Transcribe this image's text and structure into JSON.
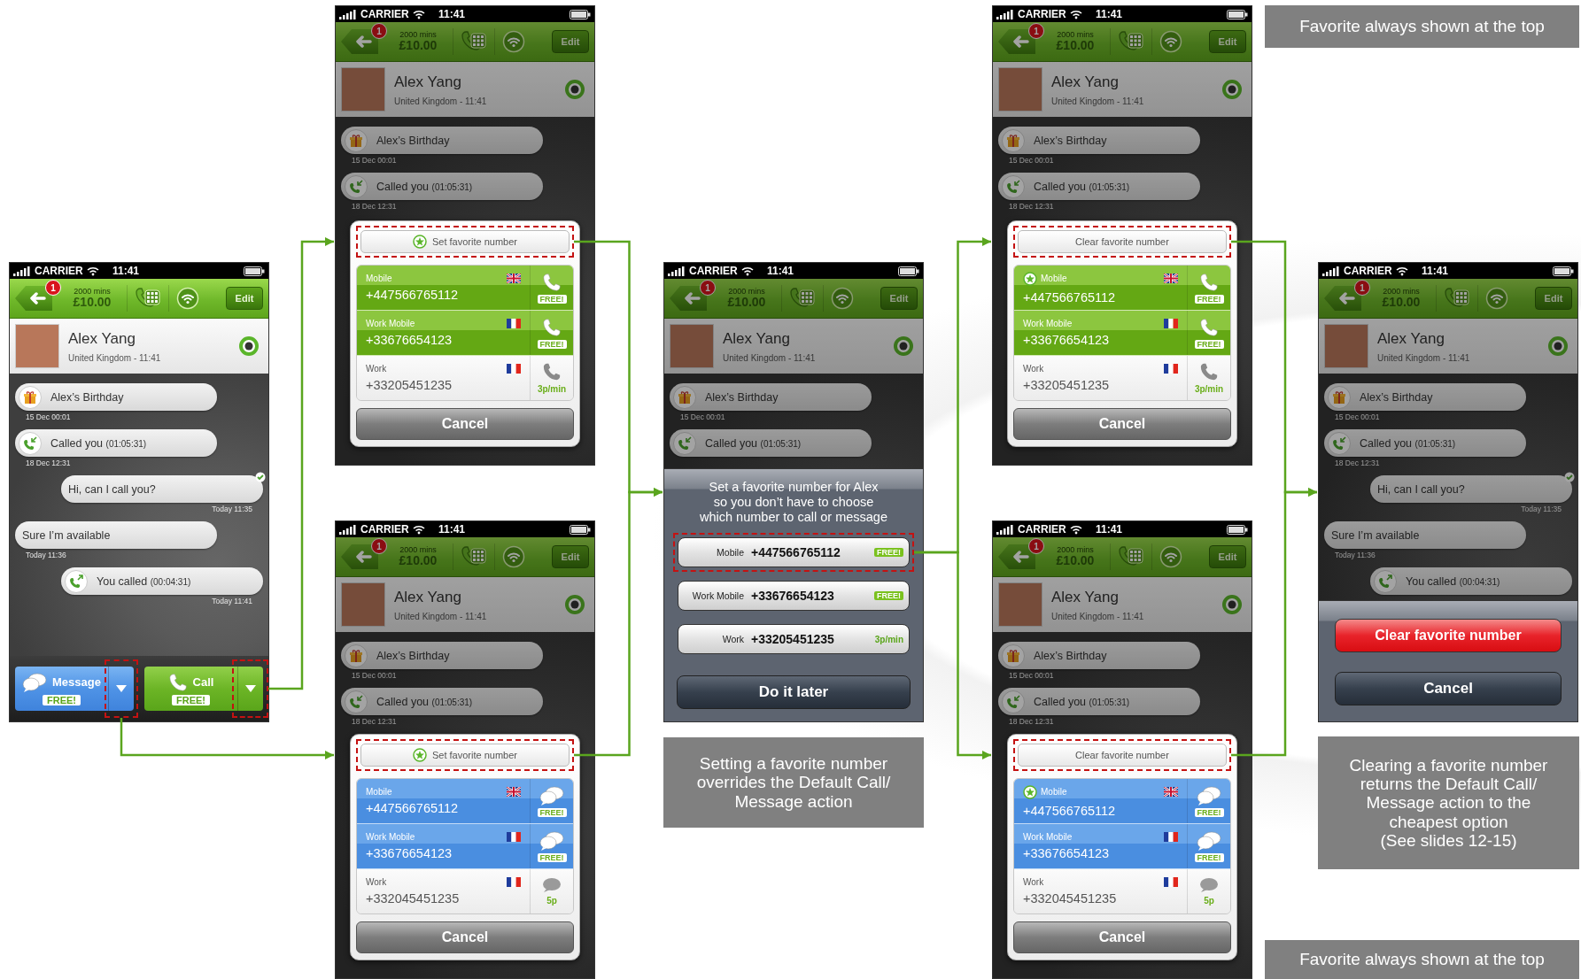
{
  "phones": [
    {
      "kind": "conversation",
      "dimmed": false,
      "status": {
        "carrier": "CARRIER",
        "time": "11:41"
      },
      "toolbar": {
        "badge": "1",
        "minutes": "2000 mins",
        "balance": "£10.00",
        "edit": "Edit"
      },
      "contact": {
        "name": "Alex Yang",
        "subtitle": "United Kingdom - 11:41"
      },
      "messages": [
        {
          "kind": "birthday",
          "outgoing": false,
          "delivered": false,
          "text": "Alex’s Birthday",
          "time": "15 Dec 00:01"
        },
        {
          "kind": "call_in",
          "outgoing": false,
          "delivered": false,
          "text": "Called you",
          "detail": "(01:05:31)",
          "time": "18 Dec 12:31"
        },
        {
          "kind": "text",
          "outgoing": true,
          "delivered": true,
          "text": "Hi, can I call you?",
          "time": "Today 11:35"
        },
        {
          "kind": "text",
          "outgoing": false,
          "delivered": false,
          "text": "Sure I’m available",
          "time": "Today 11:36"
        },
        {
          "kind": "call_out",
          "outgoing": true,
          "delivered": false,
          "text": "You called",
          "detail": "(00:04:31)",
          "time": "Today 11:41"
        }
      ],
      "bottom_bar": [
        {
          "kind": "message",
          "label": "Message",
          "price": "FREE!",
          "highlighted": true
        },
        {
          "kind": "call",
          "label": "Call",
          "price": "FREE!",
          "highlighted": true
        }
      ]
    },
    {
      "kind": "number_picker",
      "dimmed": true,
      "status": {
        "carrier": "CARRIER",
        "time": "11:41"
      },
      "toolbar": {
        "badge": "1",
        "minutes": "2000 mins",
        "balance": "£10.00",
        "edit": "Edit"
      },
      "contact": {
        "name": "Alex Yang",
        "subtitle": "United Kingdom - 11:41"
      },
      "messages": [
        {
          "kind": "birthday",
          "outgoing": false,
          "delivered": false,
          "text": "Alex’s Birthday",
          "time": "15 Dec 00:01"
        },
        {
          "kind": "call_in",
          "outgoing": false,
          "delivered": false,
          "text": "Called you",
          "detail": "(01:05:31)",
          "time": "18 Dec 12:31"
        }
      ],
      "popup": {
        "kind": "call",
        "favorite_button": {
          "label": "Set favorite number",
          "starred": true,
          "highlighted": true
        },
        "numbers": [
          {
            "label": "Mobile",
            "kind": "gb",
            "number": "+447566765112",
            "price": "FREE!",
            "free": true,
            "favorite": false
          },
          {
            "label": "Work Mobile",
            "kind": "fr",
            "number": "+33676654123",
            "price": "FREE!",
            "free": true,
            "favorite": false
          },
          {
            "label": "Work",
            "kind": "fr",
            "number": "+33205451235",
            "price": "3p/min",
            "free": false,
            "favorite": false
          }
        ],
        "cancel": "Cancel"
      }
    },
    {
      "kind": "number_picker",
      "dimmed": true,
      "status": {
        "carrier": "CARRIER",
        "time": "11:41"
      },
      "toolbar": {
        "badge": "1",
        "minutes": "2000 mins",
        "balance": "£10.00",
        "edit": "Edit"
      },
      "contact": {
        "name": "Alex Yang",
        "subtitle": "United Kingdom - 11:41"
      },
      "messages": [
        {
          "kind": "birthday",
          "outgoing": false,
          "delivered": false,
          "text": "Alex’s Birthday",
          "time": "15 Dec 00:01"
        },
        {
          "kind": "call_in",
          "outgoing": false,
          "delivered": false,
          "text": "Called you",
          "detail": "(01:05:31)",
          "time": "18 Dec 12:31"
        }
      ],
      "popup": {
        "kind": "message",
        "favorite_button": {
          "label": "Set favorite number",
          "starred": true,
          "highlighted": true
        },
        "numbers": [
          {
            "label": "Mobile",
            "kind": "gb",
            "number": "+447566765112",
            "price": "FREE!",
            "free": true,
            "favorite": false
          },
          {
            "label": "Work Mobile",
            "kind": "fr",
            "number": "+33676654123",
            "price": "FREE!",
            "free": true,
            "favorite": false
          },
          {
            "label": "Work",
            "kind": "fr",
            "number": "+332045451235",
            "price": "5p",
            "free": false,
            "favorite": false
          }
        ],
        "cancel": "Cancel"
      }
    },
    {
      "kind": "favorite_prompt",
      "dimmed": true,
      "status": {
        "carrier": "CARRIER",
        "time": "11:41"
      },
      "toolbar": {
        "badge": "1",
        "minutes": "2000 mins",
        "balance": "£10.00",
        "edit": "Edit"
      },
      "contact": {
        "name": "Alex Yang",
        "subtitle": "United Kingdom - 11:41"
      },
      "messages": [
        {
          "kind": "birthday",
          "outgoing": false,
          "delivered": false,
          "text": "Alex’s Birthday",
          "time": "15 Dec 00:01"
        },
        {
          "kind": "call_in",
          "outgoing": false,
          "delivered": false,
          "text": "Called you",
          "detail": "(01:05:31)"
        }
      ],
      "sheet": {
        "prompt": "Set a favorite number for Alex\nso you don’t have to choose\nwhich number to call or message",
        "options": [
          {
            "label": "Mobile",
            "number": "+447566765112",
            "price": "FREE!",
            "free": true,
            "highlighted": true
          },
          {
            "label": "Work Mobile",
            "number": "+33676654123",
            "price": "FREE!",
            "free": true,
            "highlighted": false
          },
          {
            "label": "Work",
            "number": "+33205451235",
            "price": "3p/min",
            "free": false,
            "highlighted": false
          }
        ],
        "dismiss": "Do it later"
      }
    },
    {
      "kind": "number_picker",
      "dimmed": true,
      "status": {
        "carrier": "CARRIER",
        "time": "11:41"
      },
      "toolbar": {
        "badge": "1",
        "minutes": "2000 mins",
        "balance": "£10.00",
        "edit": "Edit"
      },
      "contact": {
        "name": "Alex Yang",
        "subtitle": "United Kingdom - 11:41"
      },
      "messages": [
        {
          "kind": "birthday",
          "outgoing": false,
          "delivered": false,
          "text": "Alex’s Birthday",
          "time": "15 Dec 00:01"
        },
        {
          "kind": "call_in",
          "outgoing": false,
          "delivered": false,
          "text": "Called you",
          "detail": "(01:05:31)",
          "time": "18 Dec 12:31"
        }
      ],
      "popup": {
        "kind": "call",
        "favorite_button": {
          "label": "Clear favorite number",
          "starred": false,
          "highlighted": true
        },
        "numbers": [
          {
            "label": "Mobile",
            "kind": "gb",
            "number": "+447566765112",
            "price": "FREE!",
            "free": true,
            "favorite": true
          },
          {
            "label": "Work Mobile",
            "kind": "fr",
            "number": "+33676654123",
            "price": "FREE!",
            "free": true,
            "favorite": false
          },
          {
            "label": "Work",
            "kind": "fr",
            "number": "+33205451235",
            "price": "3p/min",
            "free": false,
            "favorite": false
          }
        ],
        "cancel": "Cancel"
      }
    },
    {
      "kind": "number_picker",
      "dimmed": true,
      "status": {
        "carrier": "CARRIER",
        "time": "11:41"
      },
      "toolbar": {
        "badge": "1",
        "minutes": "2000 mins",
        "balance": "£10.00",
        "edit": "Edit"
      },
      "contact": {
        "name": "Alex Yang",
        "subtitle": "United Kingdom - 11:41"
      },
      "messages": [
        {
          "kind": "birthday",
          "outgoing": false,
          "delivered": false,
          "text": "Alex’s Birthday",
          "time": "15 Dec 00:01"
        },
        {
          "kind": "call_in",
          "outgoing": false,
          "delivered": false,
          "text": "Called you",
          "detail": "(01:05:31)",
          "time": "18 Dec 12:31"
        }
      ],
      "popup": {
        "kind": "message",
        "favorite_button": {
          "label": "Clear favorite number",
          "starred": false,
          "highlighted": true
        },
        "numbers": [
          {
            "label": "Mobile",
            "kind": "gb",
            "number": "+447566765112",
            "price": "FREE!",
            "free": true,
            "favorite": true
          },
          {
            "label": "Work Mobile",
            "kind": "fr",
            "number": "+33676654123",
            "price": "FREE!",
            "free": true,
            "favorite": false
          },
          {
            "label": "Work",
            "kind": "fr",
            "number": "+332045451235",
            "price": "5p",
            "free": false,
            "favorite": false
          }
        ],
        "cancel": "Cancel"
      }
    },
    {
      "kind": "clear_favorite",
      "dimmed": true,
      "status": {
        "carrier": "CARRIER",
        "time": "11:41"
      },
      "toolbar": {
        "badge": "1",
        "minutes": "2000 mins",
        "balance": "£10.00",
        "edit": "Edit"
      },
      "contact": {
        "name": "Alex Yang",
        "subtitle": "United Kingdom - 11:41"
      },
      "messages": [
        {
          "kind": "birthday",
          "outgoing": false,
          "delivered": false,
          "text": "Alex’s Birthday",
          "time": "15 Dec 00:01"
        },
        {
          "kind": "call_in",
          "outgoing": false,
          "delivered": false,
          "text": "Called you",
          "detail": "(01:05:31)",
          "time": "18 Dec 12:31"
        },
        {
          "kind": "text",
          "outgoing": true,
          "delivered": true,
          "text": "Hi, can I call you?",
          "time": "Today 11:35"
        },
        {
          "kind": "text",
          "outgoing": false,
          "delivered": false,
          "text": "Sure I’m available",
          "time": "Today 11:36"
        },
        {
          "kind": "call_out",
          "outgoing": true,
          "delivered": false,
          "text": "You called",
          "detail": "(00:04:31)"
        }
      ],
      "sheet": {
        "confirm": "Clear favorite number",
        "dismiss": "Cancel"
      }
    }
  ],
  "captions": [
    {
      "text": "Favorite always shown at the top"
    },
    {
      "text": "Setting a favorite number\noverrides the Default Call/\nMessage action"
    },
    {
      "text": "Clearing a favorite number\nreturns the Default Call/\nMessage action to the\ncheapest option\n(See slides 12-15)"
    },
    {
      "text": "Favorite always shown at the top"
    }
  ]
}
